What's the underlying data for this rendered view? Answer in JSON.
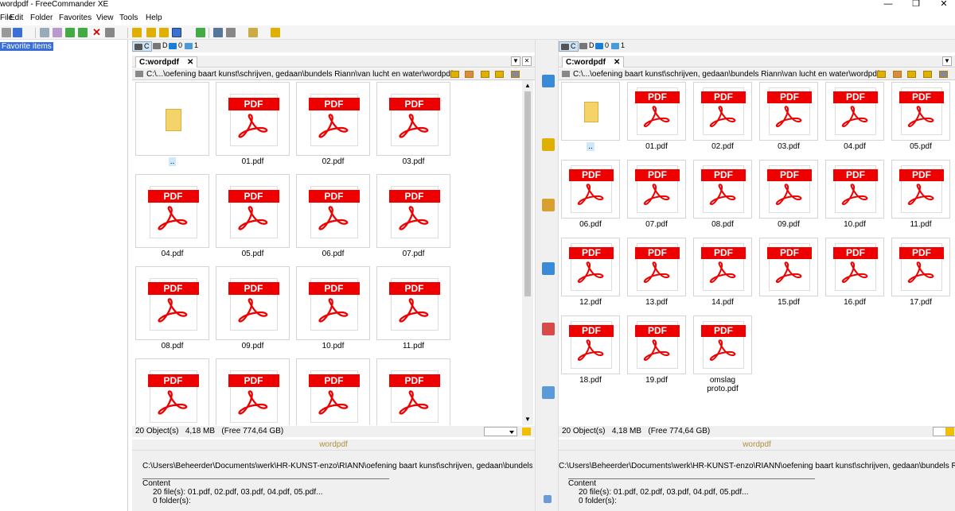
{
  "window": {
    "title": "wordpdf - FreeCommander XE",
    "controls": [
      "—",
      "❐",
      "✕"
    ]
  },
  "menu": [
    "File",
    "Edit",
    "Folder",
    "Favorites",
    "View",
    "Tools",
    "Help"
  ],
  "left_sidebar": {
    "favorite_label": "Favorite items"
  },
  "drives": [
    {
      "label": "C",
      "icon": "hdd-icon"
    },
    {
      "label": "D",
      "icon": "disc-icon"
    },
    {
      "label": "0",
      "icon": "monitor-icon"
    },
    {
      "label": "1",
      "icon": "network-icon"
    }
  ],
  "left_panel": {
    "tab": "C:wordpdf",
    "path": "C:\\...\\oefening baart kunst\\schrijven, gedaan\\bundels Riann\\van lucht en water\\wordpdf",
    "items": [
      "..",
      "01.pdf",
      "02.pdf",
      "03.pdf",
      "04.pdf",
      "05.pdf",
      "06.pdf",
      "07.pdf",
      "08.pdf",
      "09.pdf",
      "10.pdf",
      "11.pdf",
      "",
      "",
      "",
      ""
    ],
    "status": {
      "objects": "20 Object(s)",
      "size": "4,18 MB",
      "free": "(Free 774,64 GB)"
    },
    "preview": {
      "title": "wordpdf",
      "path": "C:\\Users\\Beheerder\\Documents\\werk\\HR-KUNST-enzo\\RIANN\\oefening baart kunst\\schrijven, gedaan\\bundels Riann\\",
      "content_label": "Content",
      "files": "20 file(s):  01.pdf, 02.pdf, 03.pdf, 04.pdf, 05.pdf...",
      "folders": "0 folder(s):"
    }
  },
  "right_panel": {
    "tab": "C:wordpdf",
    "path": "C:\\...\\oefening baart kunst\\schrijven, gedaan\\bundels Riann\\van lucht en water\\wordpdf",
    "items": [
      "..",
      "01.pdf",
      "02.pdf",
      "03.pdf",
      "04.pdf",
      "05.pdf",
      "06.pdf",
      "07.pdf",
      "08.pdf",
      "09.pdf",
      "10.pdf",
      "11.pdf",
      "12.pdf",
      "13.pdf",
      "14.pdf",
      "15.pdf",
      "16.pdf",
      "17.pdf",
      "18.pdf",
      "19.pdf",
      "omslag proto.pdf"
    ],
    "status": {
      "objects": "20 Object(s)",
      "size": "4,18 MB",
      "free": "(Free 774,64 GB)"
    },
    "preview": {
      "title": "wordpdf",
      "path": "C:\\Users\\Beheerder\\Documents\\werk\\HR-KUNST-enzo\\RIANN\\oefening baart kunst\\schrijven, gedaan\\bundels Riann\\",
      "content_label": "Content",
      "files": "20 file(s):  01.pdf, 02.pdf, 03.pdf, 04.pdf, 05.pdf...",
      "folders": "0 folder(s):"
    }
  },
  "pdf_label": "PDF",
  "colors": {
    "selection": "#3a6fd8",
    "pdf_red": "#e00000",
    "folder": "#f4d36a"
  }
}
